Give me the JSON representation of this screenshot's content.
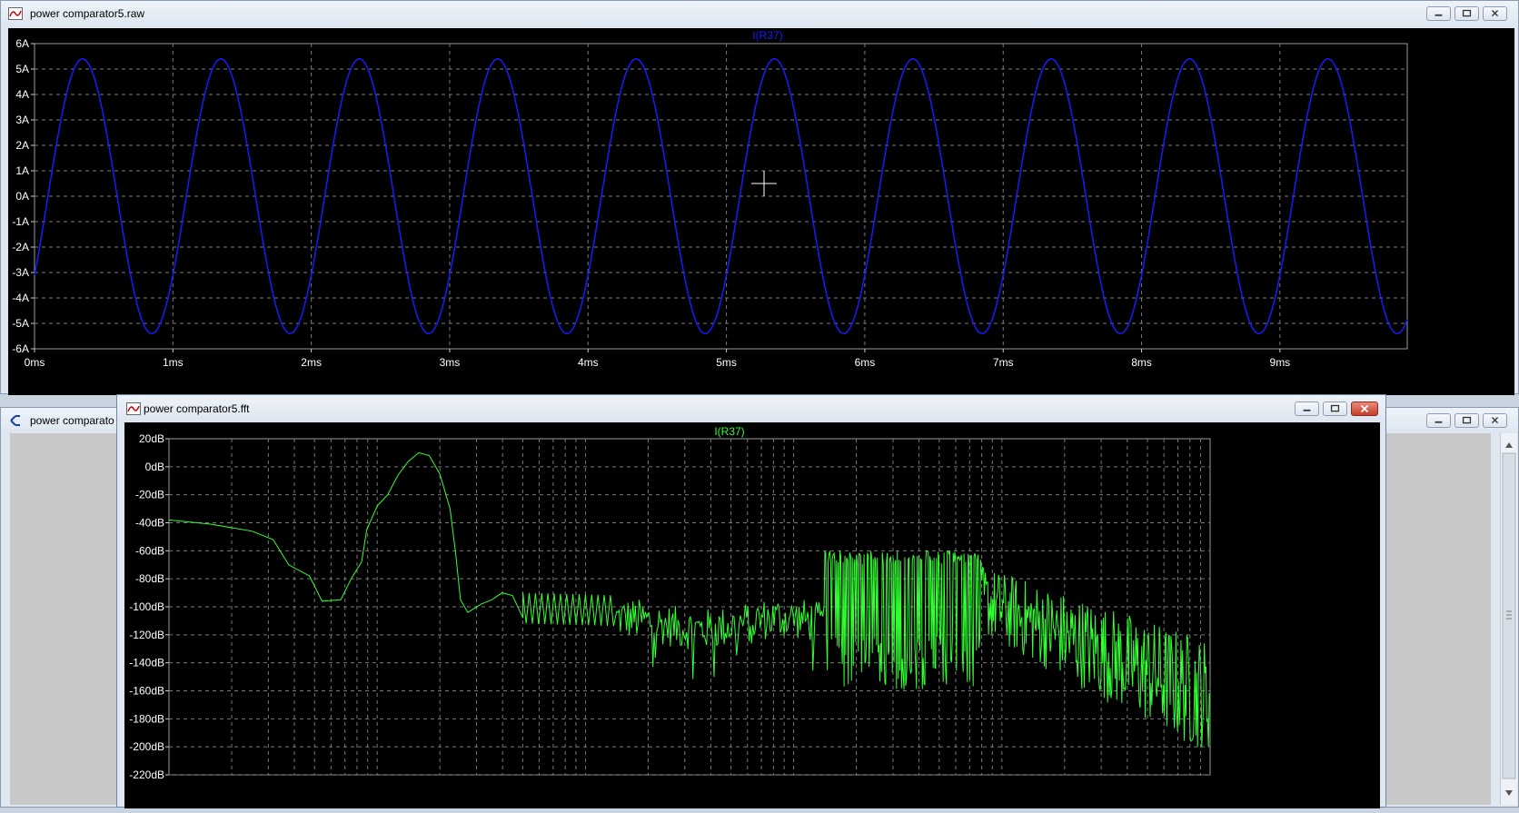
{
  "windows": {
    "raw": {
      "title": "power comparator5.raw"
    },
    "back": {
      "title": "power comparato"
    },
    "fft": {
      "title": "power comparator5.fft"
    }
  },
  "colors": {
    "time_trace": "#1a1aff",
    "fft_trace": "#33ff33",
    "plot_bg": "#000000"
  },
  "chart_data": [
    {
      "type": "line",
      "title": "I(R37)",
      "x_ticks": [
        "0ms",
        "1ms",
        "2ms",
        "3ms",
        "4ms",
        "5ms",
        "6ms",
        "7ms",
        "8ms",
        "9ms"
      ],
      "y_ticks": [
        "6A",
        "5A",
        "4A",
        "3A",
        "2A",
        "1A",
        "0A",
        "-1A",
        "-2A",
        "-3A",
        "-4A",
        "-5A",
        "-6A"
      ],
      "xlim": [
        0,
        9.92
      ],
      "ylim": [
        -6,
        6
      ],
      "series": [
        {
          "frequency_hz": 1000,
          "amplitude_a": 5.4,
          "phase_deg": -35
        }
      ]
    },
    {
      "type": "line",
      "title": "I(R37)",
      "y_ticks": [
        "20dB",
        "0dB",
        "-20dB",
        "-40dB",
        "-60dB",
        "-80dB",
        "-100dB",
        "-120dB",
        "-140dB",
        "-160dB",
        "-180dB",
        "-200dB",
        "-220dB"
      ],
      "ylim": [
        -220,
        20
      ]
    }
  ],
  "icons": {
    "waveform": "waveform-icon",
    "schematic": "schematic-icon"
  }
}
